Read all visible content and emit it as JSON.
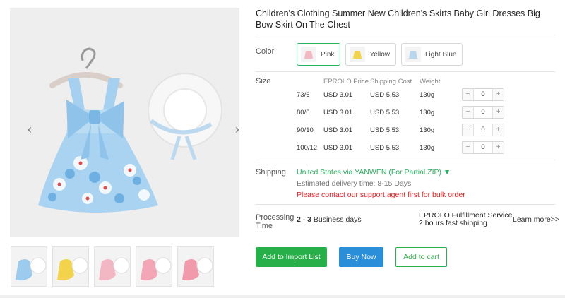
{
  "product": {
    "title": "Children's Clothing Summer New Children's Skirts Baby Girl Dresses Big Bow Skirt On The Chest"
  },
  "gallery": {
    "prev": "‹",
    "next": "›",
    "thumbnail_colors": [
      "#9ccbee",
      "#f3d24c",
      "#f3b7c4",
      "#f2a6b6",
      "#f09aac"
    ]
  },
  "color": {
    "label": "Color",
    "options": [
      {
        "name": "Pink",
        "swatch": "#f3b7c4",
        "selected": true
      },
      {
        "name": "Yellow",
        "swatch": "#f3d24c",
        "selected": false
      },
      {
        "name": "Light Blue",
        "swatch": "#b9d6ec",
        "selected": false
      }
    ]
  },
  "size": {
    "label": "Size",
    "headers": {
      "price": "EPROLO Price",
      "shipping": "Shipping Cost",
      "weight": "Weight"
    },
    "rows": [
      {
        "size": "73/6",
        "price": "USD 3.01",
        "shipping": "USD 5.53",
        "weight": "130g",
        "qty": "0"
      },
      {
        "size": "80/6",
        "price": "USD 3.01",
        "shipping": "USD 5.53",
        "weight": "130g",
        "qty": "0"
      },
      {
        "size": "90/10",
        "price": "USD 3.01",
        "shipping": "USD 5.53",
        "weight": "130g",
        "qty": "0"
      },
      {
        "size": "100/12",
        "price": "USD 3.01",
        "shipping": "USD 5.53",
        "weight": "130g",
        "qty": "0"
      }
    ],
    "minus": "−",
    "plus": "+"
  },
  "shipping": {
    "label": "Shipping",
    "method": "United States via YANWEN (For Partial ZIP) ▼",
    "delivery": "Estimated delivery time: 8-15 Days",
    "warning": "Please contact our support agent first for bulk order"
  },
  "processing": {
    "label_line1": "Processing",
    "label_line2": "Time",
    "range": "2 - 3",
    "unit": " Business days",
    "service_line1": "EPROLO Fulfillment Service",
    "service_line2": "2 hours fast shipping",
    "learn_more": "Learn more>>"
  },
  "actions": {
    "import": "Add to Import List",
    "buy": "Buy Now",
    "cart": "Add to cart"
  },
  "colors": {
    "accent_green": "#27b04a",
    "buy_blue": "#2a8fd8",
    "warning_red": "#e02020"
  }
}
